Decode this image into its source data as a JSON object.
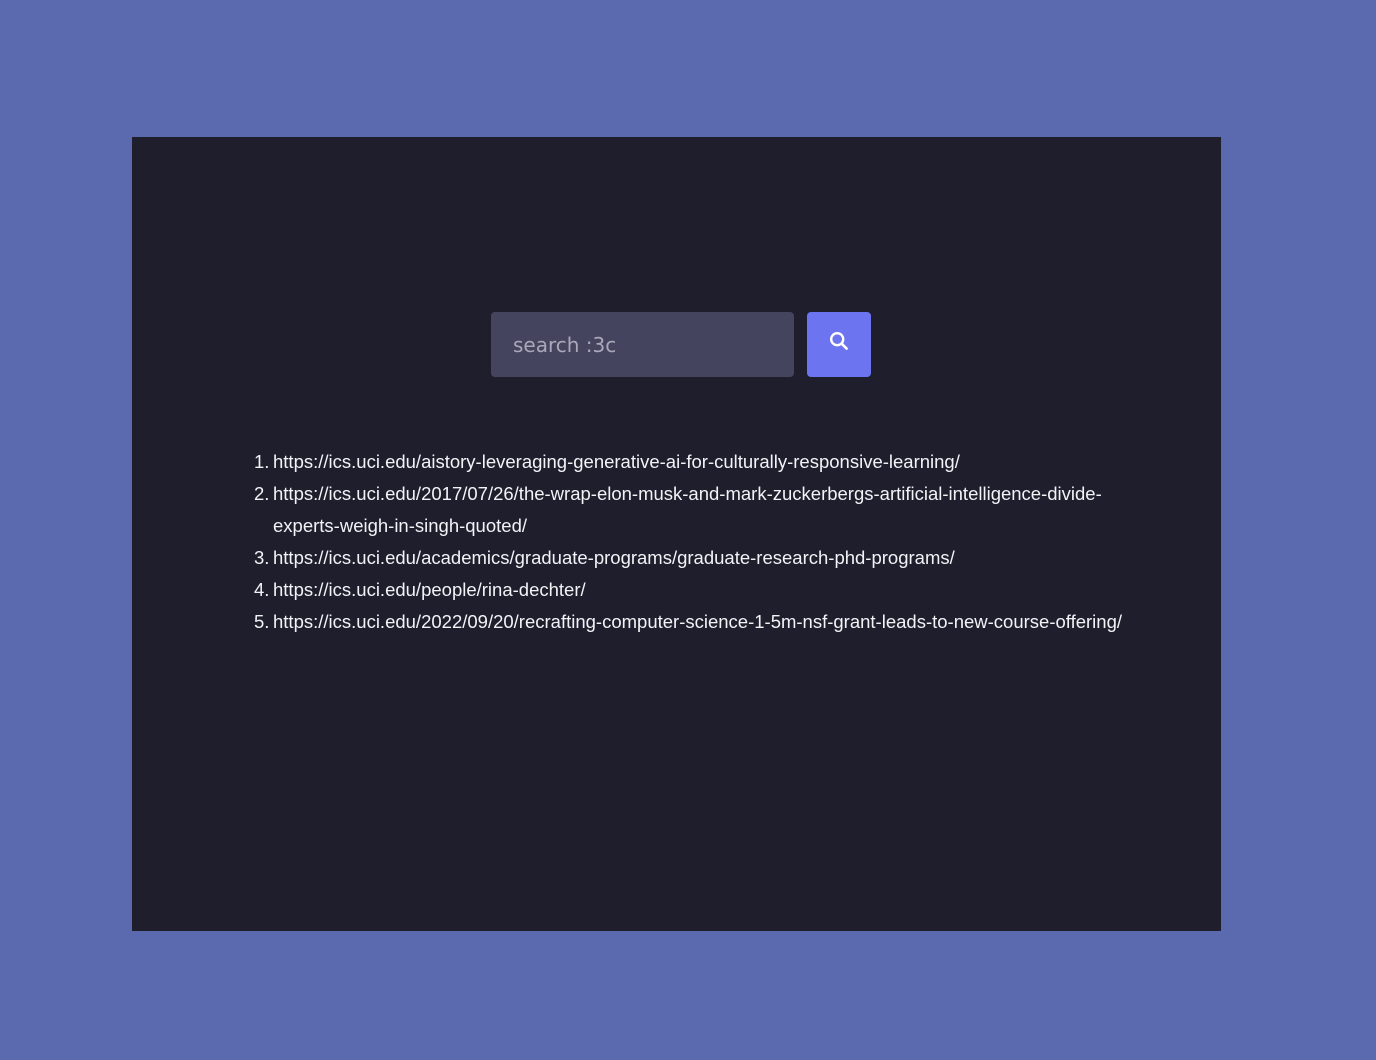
{
  "search": {
    "placeholder": "search :3c",
    "value": ""
  },
  "icons": {
    "search_button_icon": "search-icon"
  },
  "colors": {
    "page_background": "#5b69ae",
    "panel_background": "#1e1e2c",
    "input_background": "#45445e",
    "button_accent": "#6c74f0",
    "text": "#f2f2f7"
  },
  "results": [
    {
      "number": "1.",
      "url": "https://ics.uci.edu/aistory-leveraging-generative-ai-for-culturally-responsive-learning/"
    },
    {
      "number": "2.",
      "url": "https://ics.uci.edu/2017/07/26/the-wrap-elon-musk-and-mark-zuckerbergs-artificial-intelligence-divide-experts-weigh-in-singh-quoted/"
    },
    {
      "number": "3.",
      "url": "https://ics.uci.edu/academics/graduate-programs/graduate-research-phd-programs/"
    },
    {
      "number": "4.",
      "url": "https://ics.uci.edu/people/rina-dechter/"
    },
    {
      "number": "5.",
      "url": "https://ics.uci.edu/2022/09/20/recrafting-computer-science-1-5m-nsf-grant-leads-to-new-course-offering/"
    }
  ]
}
